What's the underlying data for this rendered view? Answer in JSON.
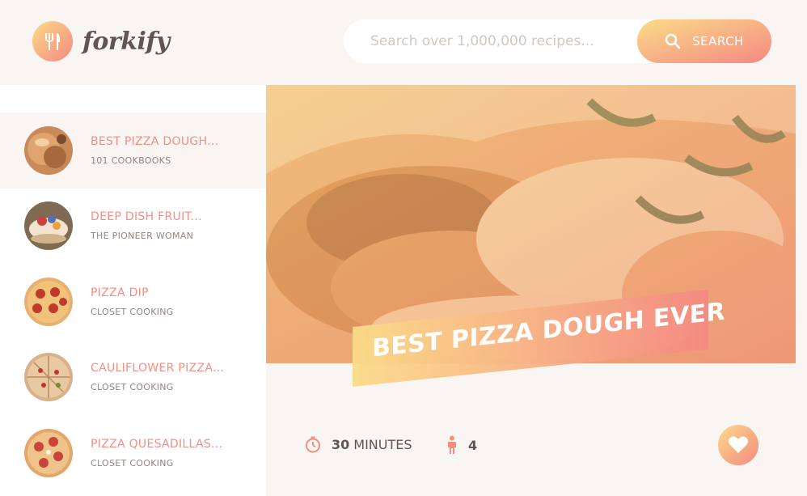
{
  "app": {
    "logo_text": "forkify"
  },
  "search": {
    "placeholder": "Search over 1,000,000 recipes...",
    "button_label": "SEARCH"
  },
  "results": [
    {
      "title": "BEST PIZZA DOUGH...",
      "author": "101 COOKBOOKS",
      "active": true
    },
    {
      "title": "DEEP DISH FRUIT...",
      "author": "THE PIONEER WOMAN",
      "active": false
    },
    {
      "title": "PIZZA DIP",
      "author": "CLOSET COOKING",
      "active": false
    },
    {
      "title": "CAULIFLOWER PIZZA...",
      "author": "CLOSET COOKING",
      "active": false
    },
    {
      "title": "PIZZA QUESADILLAS...",
      "author": "CLOSET COOKING",
      "active": false
    }
  ],
  "recipe": {
    "title": "BEST PIZZA DOUGH EVER",
    "time": "30",
    "time_unit": "MINUTES",
    "servings": "4"
  },
  "colors": {
    "accent_start": "#fbdb89",
    "accent_end": "#f48982",
    "title": "#f38e82",
    "background": "#f9f5f3"
  },
  "icons": [
    "fork-knife-icon",
    "search-icon",
    "timer-icon",
    "person-icon",
    "heart-icon"
  ]
}
